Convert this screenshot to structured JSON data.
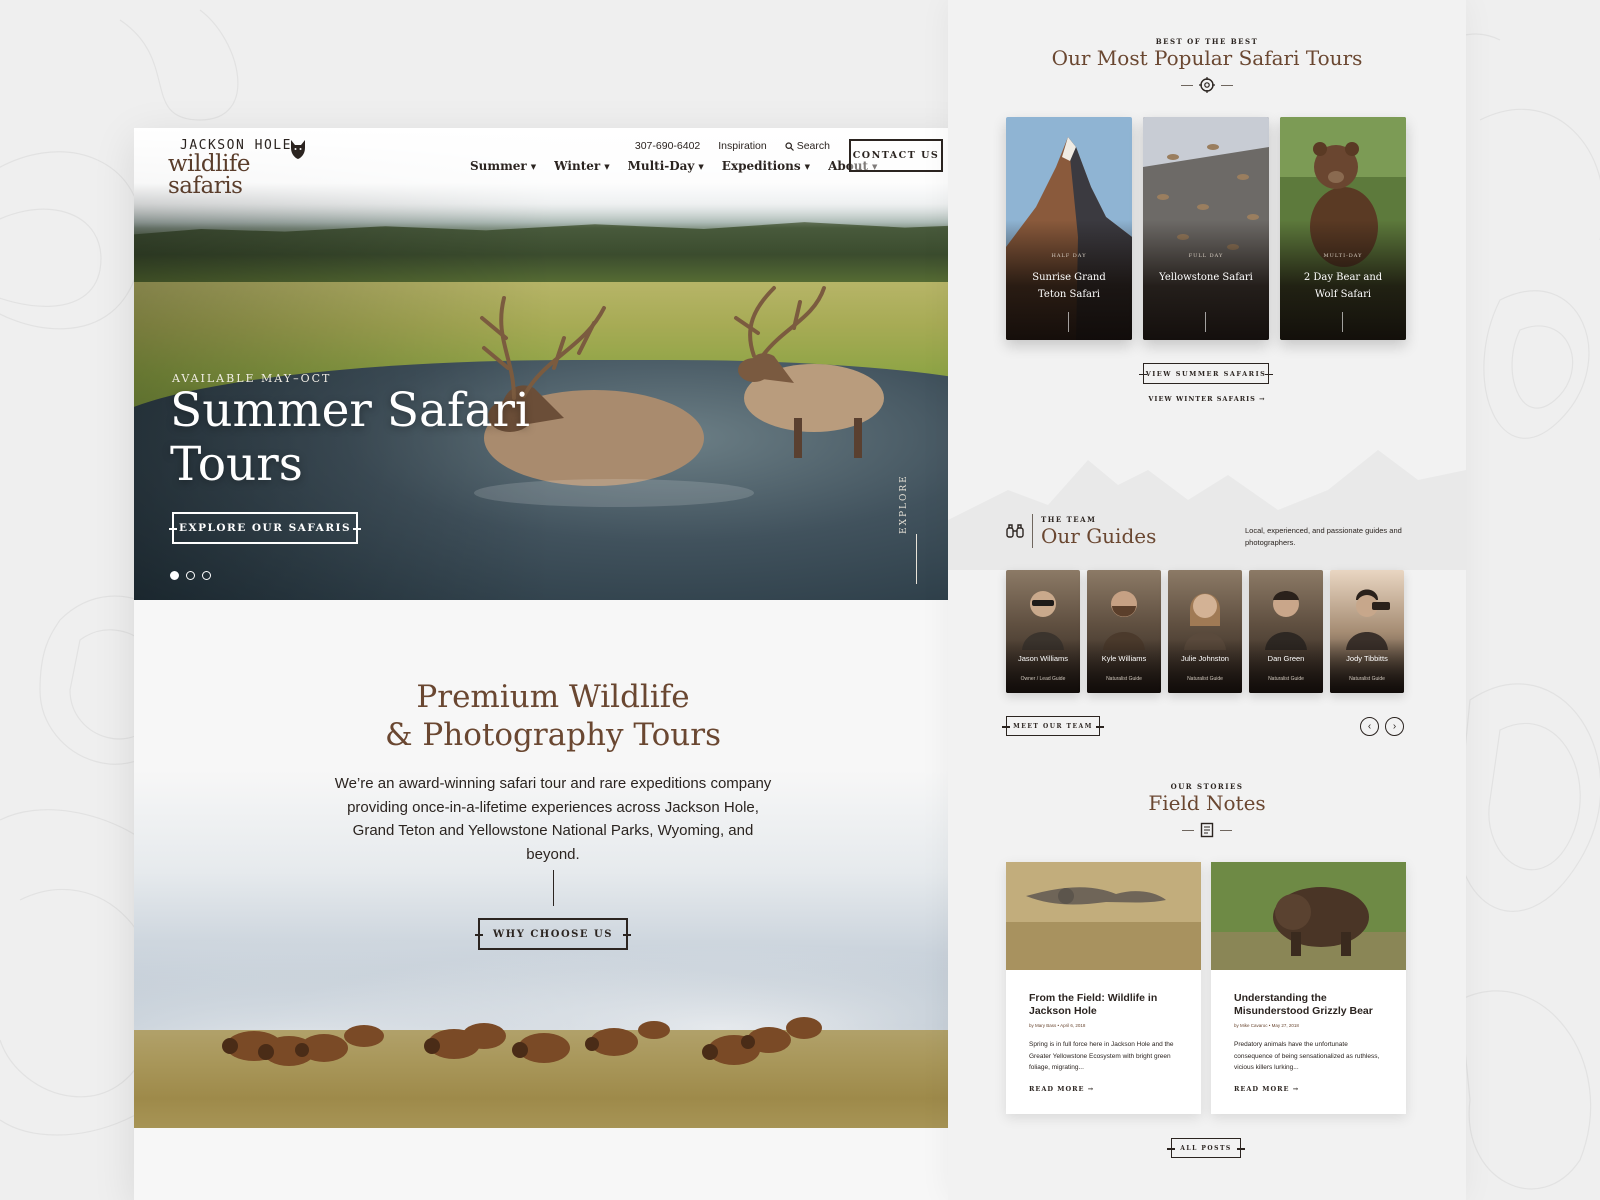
{
  "header": {
    "logo_line1": "JACKSON HOLE",
    "logo_line2": "wildlife safaris",
    "phone": "307-690-6402",
    "inspiration": "Inspiration",
    "search": "Search",
    "contact_label": "CONTACT US",
    "nav": [
      "Summer",
      "Winter",
      "Multi-Day",
      "Expeditions",
      "About"
    ]
  },
  "hero": {
    "eyebrow": "AVAILABLE MAY–OCT",
    "title": "Summer Safari Tours",
    "cta": "EXPLORE OUR SAFARIS",
    "side_label": "EXPLORE",
    "slides": 3,
    "active_slide": 1
  },
  "intro": {
    "title_line1": "Premium Wildlife",
    "title_line2": "& Photography Tours",
    "body": "We’re an award-winning safari tour and rare expeditions company providing once-in-a-lifetime experiences across Jackson Hole, Grand Teton and Yellowstone National Parks, Wyoming, and beyond.",
    "cta": "WHY CHOOSE US"
  },
  "tours": {
    "eyebrow": "BEST OF THE BEST",
    "title": "Our Most Popular Safari Tours",
    "cards": [
      {
        "tag": "HALF DAY",
        "name": "Sunrise Grand Teton Safari"
      },
      {
        "tag": "FULL DAY",
        "name": "Yellowstone Safari"
      },
      {
        "tag": "MULTI-DAY",
        "name": "2 Day Bear and Wolf Safari"
      }
    ],
    "summer_cta": "VIEW SUMMER SAFARIS",
    "winter_link": "VIEW WINTER SAFARIS →"
  },
  "guides": {
    "eyebrow": "THE TEAM",
    "title": "Our Guides",
    "description": "Local, experienced, and passionate guides and photographers.",
    "cards": [
      {
        "name": "Jason Williams",
        "role": "Owner / Lead Guide"
      },
      {
        "name": "Kyle Williams",
        "role": "Naturalist Guide"
      },
      {
        "name": "Julie Johnston",
        "role": "Naturalist Guide"
      },
      {
        "name": "Dan Green",
        "role": "Naturalist Guide"
      },
      {
        "name": "Jody Tibbitts",
        "role": "Naturalist Guide"
      }
    ],
    "cta": "MEET OUR TEAM",
    "prev": "‹",
    "next": "›"
  },
  "stories": {
    "eyebrow": "OUR STORIES",
    "title": "Field Notes",
    "cards": [
      {
        "title": "From the Field: Wildlife in Jackson Hole",
        "meta": "by Mary Bass • April 6, 2018",
        "excerpt": "Spring is in full force here in Jackson Hole and the Greater Yellowstone Ecosystem with bright green foliage, migrating...",
        "read_more": "READ MORE →"
      },
      {
        "title": "Understanding the Misunderstood Grizzly Bear",
        "meta": "by Mike Cavaroc • May 27, 2018",
        "excerpt": "Predatory animals have the unfortunate consequence of being sensationalized as ruthless, vicious killers lurking...",
        "read_more": "READ MORE →"
      }
    ],
    "cta": "ALL POSTS"
  },
  "colors": {
    "brand_brown": "#6a4731",
    "ink": "#2b2420",
    "background": "#efefef"
  }
}
